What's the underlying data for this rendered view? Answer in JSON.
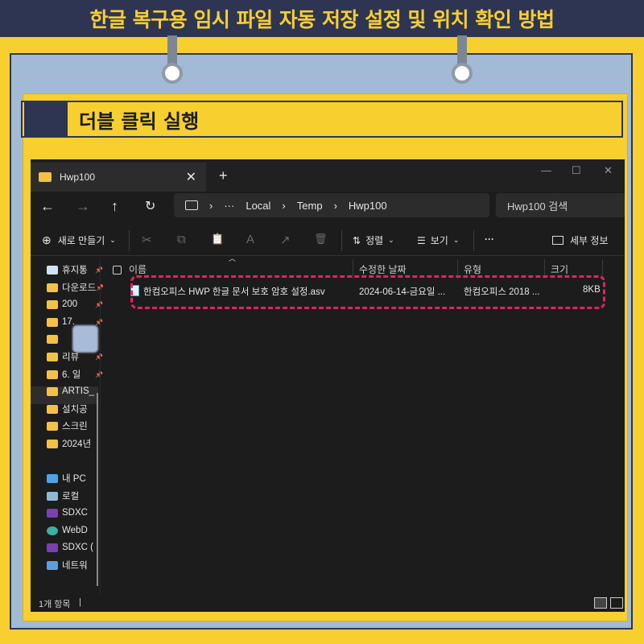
{
  "banner": {
    "title": "한글 복구용 임시 파일 자동 저장 설정 및 위치 확인 방법"
  },
  "subheading": {
    "text": "더블 클릭 실행"
  },
  "window": {
    "tab_title": "Hwp100",
    "close_glyph": "✕",
    "newtab_glyph": "+",
    "controls": [
      "—",
      "☐",
      "✕"
    ]
  },
  "nav": {
    "back": "←",
    "forward": "→",
    "up": "↑",
    "refresh": "↻",
    "breadcrumb": [
      "›",
      "···",
      "Local",
      "›",
      "Temp",
      "›",
      "Hwp100"
    ],
    "search_placeholder": "Hwp100 검색"
  },
  "toolbar": {
    "new_label": "새로 만들기",
    "sort_label": "정렬",
    "view_label": "보기",
    "more_label": "···",
    "details_label": "세부 정보",
    "icons": [
      "✂",
      "⧉",
      "📋",
      "A",
      "↗",
      "🗑"
    ]
  },
  "sidebar": {
    "items": [
      {
        "label": "휴지통",
        "pinned": true
      },
      {
        "label": "다운로드",
        "pinned": true
      },
      {
        "label": "200",
        "pinned": true
      },
      {
        "label": "17.",
        "pinned": true
      },
      {
        "label": "",
        "pinned": false
      },
      {
        "label": "리뷰",
        "pinned": true
      },
      {
        "label": "6. 일",
        "pinned": true
      },
      {
        "label": "ARTIS_",
        "pinned": false
      },
      {
        "label": "설치공",
        "pinned": false
      },
      {
        "label": "스크린",
        "pinned": false
      },
      {
        "label": "2024년",
        "pinned": false
      }
    ],
    "drives": [
      {
        "label": "내 PC"
      },
      {
        "label": "로컬"
      },
      {
        "label": "SDXC"
      },
      {
        "label": "WebD"
      },
      {
        "label": "SDXC ("
      },
      {
        "label": "네트워"
      }
    ]
  },
  "columns": {
    "name": "이름",
    "date": "수정한 날짜",
    "type": "유형",
    "size": "크기"
  },
  "files": [
    {
      "name": "한컴오피스 HWP 한글 문서 보호 암호 설정.asv",
      "date": "2024-06-14-금요일 ...",
      "type": "한컴오피스 2018 ...",
      "size": "8KB"
    }
  ],
  "status": {
    "text": "1개 항목"
  },
  "colors": {
    "banner_bg": "#2e3553",
    "accent_yellow": "#f7cf2e",
    "highlight": "#e0245e",
    "board": "#a3bad7"
  }
}
